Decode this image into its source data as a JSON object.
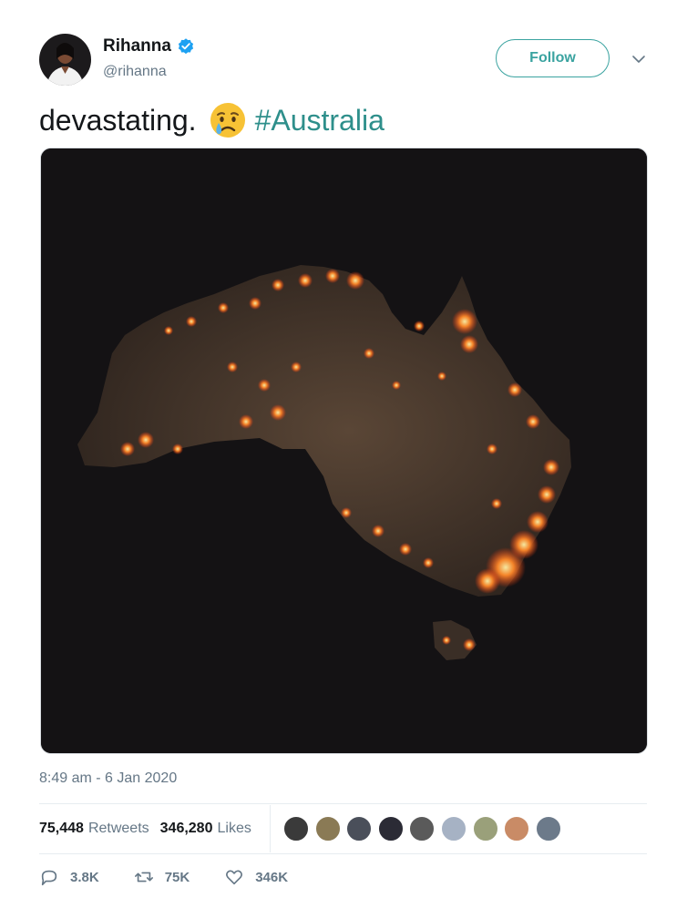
{
  "author": {
    "display_name": "Rihanna",
    "handle": "@rihanna",
    "verified": true
  },
  "follow_button": {
    "label": "Follow"
  },
  "tweet": {
    "text": "devastating.",
    "emoji": "crying-face",
    "hashtag": "#Australia"
  },
  "media": {
    "description": "dark-australia-fire-map"
  },
  "timestamp": "8:49 am - 6 Jan 2020",
  "stats": {
    "retweets_count": "75,448",
    "retweets_label": "Retweets",
    "likes_count": "346,280",
    "likes_label": "Likes"
  },
  "likers": [
    {
      "color": "#3a3a3a"
    },
    {
      "color": "#8a7a55"
    },
    {
      "color": "#4a4f5a"
    },
    {
      "color": "#2b2b35"
    },
    {
      "color": "#5a5a5a"
    },
    {
      "color": "#a6b2c4"
    },
    {
      "color": "#9aa07a"
    },
    {
      "color": "#c98b66"
    },
    {
      "color": "#6c7a8a"
    }
  ],
  "actions": {
    "replies": "3.8K",
    "retweets": "75K",
    "likes": "346K"
  },
  "colors": {
    "accent": "#3aa3a0",
    "hashtag": "#2e8f8b",
    "muted": "#657786",
    "verified": "#1da1f2"
  }
}
